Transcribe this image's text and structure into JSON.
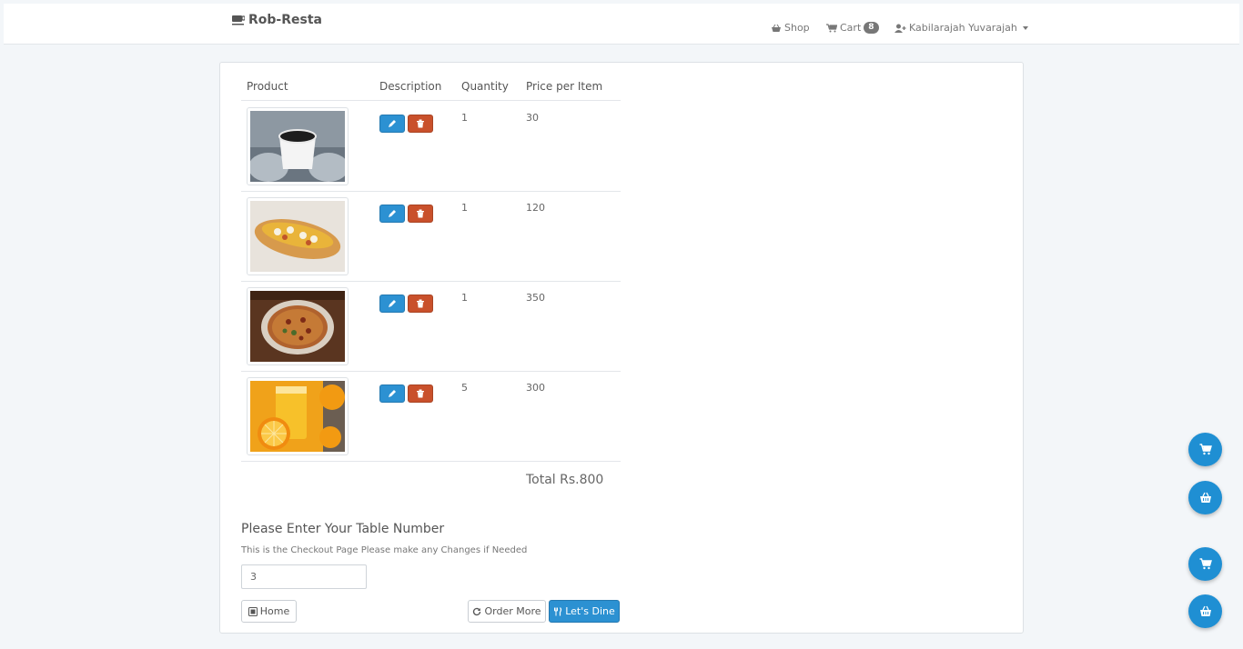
{
  "navbar": {
    "brand": "Rob-Resta",
    "brand_icon": "coffee-icon",
    "shop_label": "Shop",
    "cart_label": "Cart",
    "cart_count": "8",
    "user_name": "Kabilarajah Yuvarajah"
  },
  "table": {
    "headers": {
      "product": "Product",
      "description": "Description",
      "quantity": "Quantity",
      "price": "Price per Item"
    },
    "rows": [
      {
        "image": "coffee-cup-image",
        "quantity": "1",
        "price": "30"
      },
      {
        "image": "hot-dog-image",
        "quantity": "1",
        "price": "120"
      },
      {
        "image": "pizza-image",
        "quantity": "1",
        "price": "350"
      },
      {
        "image": "orange-juice-image",
        "quantity": "5",
        "price": "300"
      }
    ],
    "total": "Total Rs.800"
  },
  "form": {
    "title": "Please Enter Your Table Number",
    "help_text": "This is the Checkout Page Please make any Changes if Needed",
    "table_number_value": "3"
  },
  "buttons": {
    "home": "Home",
    "order_more": "Order More",
    "lets_dine": "Let's Dine"
  },
  "colors": {
    "primary": "#2c91d2",
    "danger": "#c9502b",
    "fab": "#1f8fd3",
    "background": "#f3f6f9"
  }
}
